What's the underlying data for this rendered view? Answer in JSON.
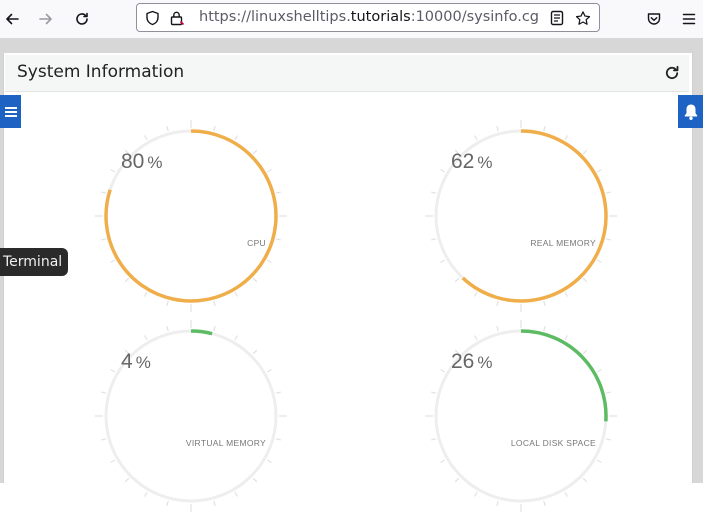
{
  "browser": {
    "url_prefix": "https://linuxshelltips.",
    "url_domain": "tutorials",
    "url_suffix": ":10000/sysinfo.cgi?",
    "icons": [
      "back-arrow-icon",
      "forward-arrow-icon",
      "reload-icon",
      "shield-icon",
      "lock-icon",
      "reader-view-icon",
      "bookmark-star-icon",
      "pocket-icon",
      "hamburger-menu-icon"
    ]
  },
  "panel": {
    "title": "System Information"
  },
  "tooltip": {
    "text": "Terminal"
  },
  "colors": {
    "high": "#efae4a",
    "low": "#5dbb63",
    "track": "#eeeeee",
    "accent": "#1e62c4"
  },
  "gauges": [
    {
      "label": "CPU",
      "value": "80",
      "unit": "%",
      "percent": 80,
      "color": "#efae4a"
    },
    {
      "label": "REAL MEMORY",
      "value": "62",
      "unit": "%",
      "percent": 62,
      "color": "#efae4a"
    },
    {
      "label": "VIRTUAL MEMORY",
      "value": "4",
      "unit": "%",
      "percent": 4,
      "color": "#5dbb63"
    },
    {
      "label": "LOCAL DISK SPACE",
      "value": "26",
      "unit": "%",
      "percent": 26,
      "color": "#5dbb63"
    }
  ]
}
